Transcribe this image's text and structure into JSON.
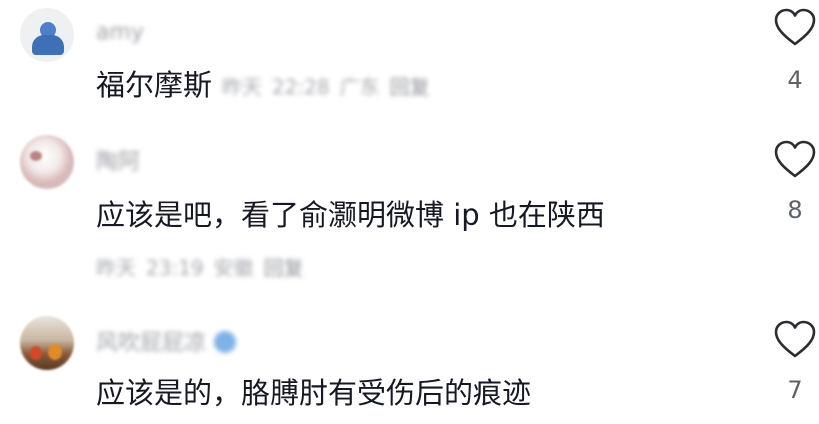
{
  "comments": [
    {
      "username": "amy",
      "text": "福尔摩斯",
      "meta": {
        "date": "昨天",
        "time": "22:28",
        "location": "广东",
        "reply": "回复"
      },
      "likes": "4"
    },
    {
      "username": "陶阿",
      "text": "应该是吧，看了俞灏明微博 ip 也在陕西",
      "meta": {
        "date": "昨天",
        "time": "23:19",
        "location": "安徽",
        "reply": "回复"
      },
      "likes": "8"
    },
    {
      "username": "风吹屁屁凉",
      "text": "应该是的，胳膊肘有受伤后的痕迹",
      "likes": "7"
    }
  ],
  "icons": {
    "like": "heart-outline-icon",
    "verified": "verified-badge-icon"
  },
  "colors": {
    "text": "#161823",
    "meta": "#a5a7ad",
    "icon": "#2b2d33"
  }
}
